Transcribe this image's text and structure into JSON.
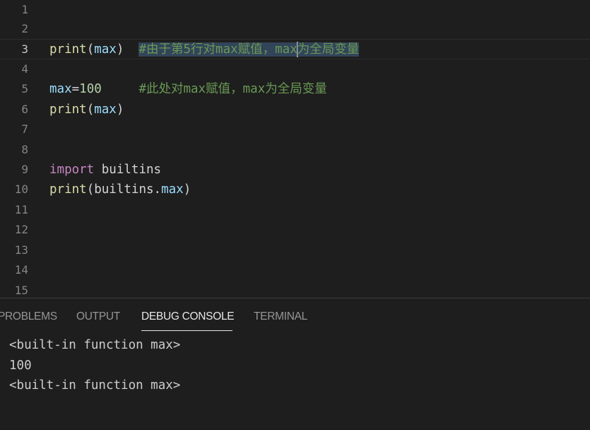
{
  "editor": {
    "line_numbers": [
      "1",
      "2",
      "3",
      "4",
      "5",
      "6",
      "7",
      "8",
      "9",
      "10",
      "11",
      "12",
      "13",
      "14",
      "15"
    ],
    "active_line": "3",
    "line3": {
      "fn": "print",
      "open": "(",
      "arg": "max",
      "close": ")",
      "comment_a": "#由于第5行对max赋值，max",
      "comment_b": "为全局变量"
    },
    "line5": {
      "var": "max",
      "op": "=",
      "num": "100",
      "comment": "#此处对max赋值，max为全局变量"
    },
    "line6": {
      "fn": "print",
      "open": "(",
      "arg": "max",
      "close": ")"
    },
    "line9": {
      "kw": "import",
      "mod": "builtins"
    },
    "line10": {
      "fn": "print",
      "open": "(",
      "mod": "builtins",
      "dot": ".",
      "attr": "max",
      "close": ")"
    }
  },
  "panel": {
    "tabs": [
      {
        "label": "PROBLEMS"
      },
      {
        "label": "OUTPUT"
      },
      {
        "label": "DEBUG CONSOLE"
      },
      {
        "label": "TERMINAL"
      }
    ],
    "active_tab": "DEBUG CONSOLE",
    "console_lines": [
      "<built-in function max>",
      "100",
      "<built-in function max>"
    ]
  },
  "colors": {
    "background": "#1e1e1e",
    "function": "#dcdcaa",
    "variable": "#9cdcfe",
    "keyword": "#c586c0",
    "number": "#b5cea8",
    "comment": "#6a9955",
    "selection": "#3a516e",
    "line_number": "#858585"
  }
}
